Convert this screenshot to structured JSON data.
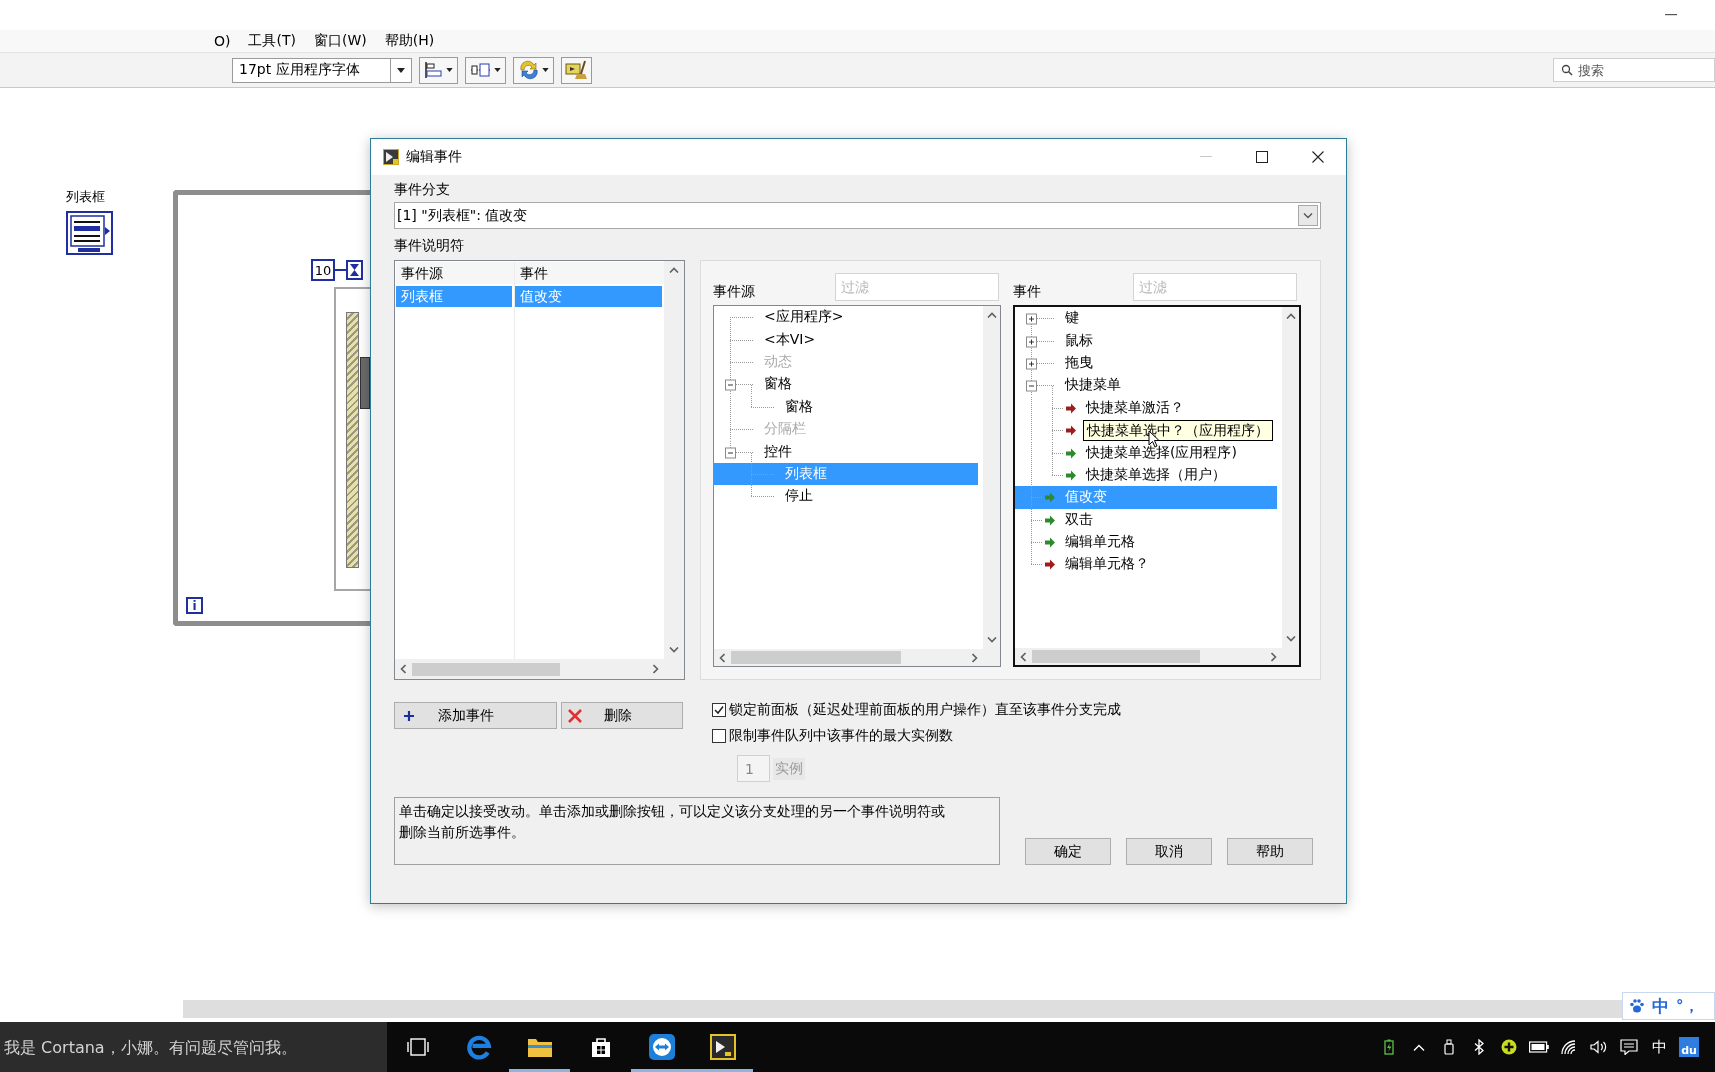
{
  "window": {
    "menu": [
      "O)",
      "工具(T)",
      "窗口(W)",
      "帮助(H)"
    ],
    "font_menu": "17pt 应用程序字体",
    "search": {
      "placeholder": "搜索"
    }
  },
  "diagram": {
    "listbox_label": "列表框",
    "wait_constant": "10",
    "iteration_terminal": "i"
  },
  "dialog": {
    "title": "编辑事件",
    "case_label": "事件分支",
    "case_value": "[1] \"列表框\": 值改变",
    "specifiers_label": "事件说明符",
    "specifiers": {
      "columns": [
        "事件源",
        "事件"
      ],
      "rows": [
        {
          "source": "列表框",
          "event": "值改变",
          "selected": true
        }
      ]
    },
    "sources": {
      "label": "事件源",
      "filter_placeholder": "过滤",
      "tree": [
        {
          "label": "<应用程序>",
          "selected": false,
          "disabled": false
        },
        {
          "label": "<本VI>",
          "selected": false,
          "disabled": false
        },
        {
          "label": "动态",
          "selected": false,
          "disabled": true
        },
        {
          "label": "窗格",
          "expanded": true,
          "selected": false,
          "disabled": false,
          "children": [
            {
              "label": "窗格",
              "selected": false,
              "disabled": false
            }
          ]
        },
        {
          "label": "分隔栏",
          "selected": false,
          "disabled": true
        },
        {
          "label": "控件",
          "expanded": true,
          "selected": false,
          "disabled": false,
          "children": [
            {
              "label": "列表框",
              "selected": true,
              "disabled": false
            },
            {
              "label": "停止",
              "selected": false,
              "disabled": false
            }
          ]
        }
      ]
    },
    "events": {
      "label": "事件",
      "filter_placeholder": "过滤",
      "tree": [
        {
          "label": "键",
          "expanded": false,
          "selected": false,
          "hovered": false
        },
        {
          "label": "鼠标",
          "expanded": false,
          "selected": false,
          "hovered": false
        },
        {
          "label": "拖曳",
          "expanded": false,
          "selected": false,
          "hovered": false
        },
        {
          "label": "快捷菜单",
          "expanded": true,
          "selected": false,
          "hovered": false,
          "children": [
            {
              "label": "快捷菜单激活？",
              "color": "#a01c1c",
              "selected": false,
              "hovered": false
            },
            {
              "label": "快捷菜单选中？（应用程序）",
              "color": "#a01c1c",
              "selected": false,
              "hovered": true
            },
            {
              "label": "快捷菜单选择(应用程序)",
              "color": "#2f8a2f",
              "selected": false,
              "hovered": false
            },
            {
              "label": "快捷菜单选择（用户）",
              "color": "#2f8a2f",
              "selected": false,
              "hovered": false
            }
          ]
        },
        {
          "label": "值改变",
          "color": "#2f8a2f",
          "selected": true,
          "hovered": false
        },
        {
          "label": "双击",
          "color": "#2f8a2f",
          "selected": false,
          "hovered": false
        },
        {
          "label": "编辑单元格",
          "color": "#2f8a2f",
          "selected": false,
          "hovered": false
        },
        {
          "label": "编辑单元格？",
          "color": "#a01c1c",
          "selected": false,
          "hovered": false
        }
      ]
    },
    "add_button": "添加事件",
    "delete_button": "删除",
    "options": [
      {
        "label": "锁定前面板（延迟处理前面板的用户操作）直至该事件分支完成",
        "checked": true
      },
      {
        "label": "限制事件队列中该事件的最大实例数",
        "checked": false
      }
    ],
    "instances": {
      "value": "1",
      "label": "实例",
      "disabled": true
    },
    "help_text": "单击确定以接受改动。单击添加或删除按钮，可以定义该分支处理的另一个事件说明符或删除当前所选事件。",
    "buttons": [
      "确定",
      "取消",
      "帮助"
    ]
  },
  "taskbar": {
    "search": {
      "placeholder": "我是 Cortana，小娜。有问题尽管问我。"
    },
    "apps": [
      {
        "kind": "task-view",
        "running": false
      },
      {
        "kind": "edge",
        "running": false
      },
      {
        "kind": "explorer",
        "running": true
      },
      {
        "kind": "store",
        "running": false
      },
      {
        "kind": "teamviewer",
        "running": true
      },
      {
        "kind": "labview",
        "running": true
      }
    ],
    "ime_mode": "中",
    "ime_logo": "du"
  },
  "ime_bar": {
    "mode": "中",
    "punctuation": "°，"
  }
}
